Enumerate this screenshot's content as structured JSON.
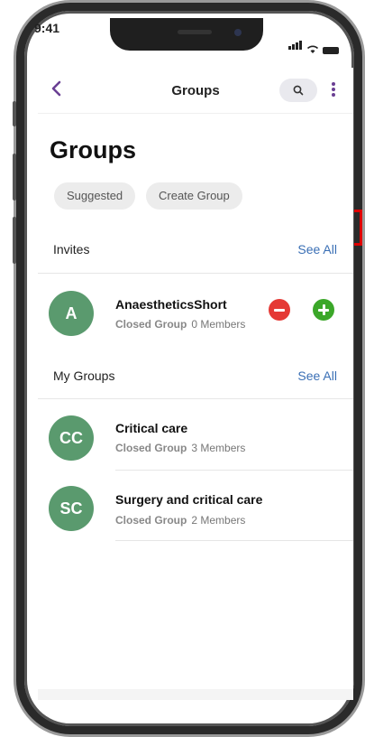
{
  "status_bar": {
    "time": "9:41"
  },
  "header": {
    "title": "Groups"
  },
  "page": {
    "title": "Groups"
  },
  "chips": [
    {
      "label": "Suggested"
    },
    {
      "label": "Create Group"
    }
  ],
  "invites": {
    "title": "Invites",
    "see_all": "See All",
    "items": [
      {
        "initials": "A",
        "name": "AnaestheticsShort",
        "type": "Closed Group",
        "members": "0 Members"
      }
    ]
  },
  "my_groups": {
    "title": "My Groups",
    "see_all": "See All",
    "items": [
      {
        "initials": "CC",
        "name": "Critical care",
        "type": "Closed Group",
        "members": "3 Members"
      },
      {
        "initials": "SC",
        "name": "Surgery and critical care",
        "type": "Closed Group",
        "members": "2 Members"
      }
    ]
  },
  "colors": {
    "accent": "#6a3f93",
    "link": "#3a6fb5",
    "avatar": "#5a9a6e",
    "decline": "#e53935",
    "accept": "#3ba729"
  }
}
